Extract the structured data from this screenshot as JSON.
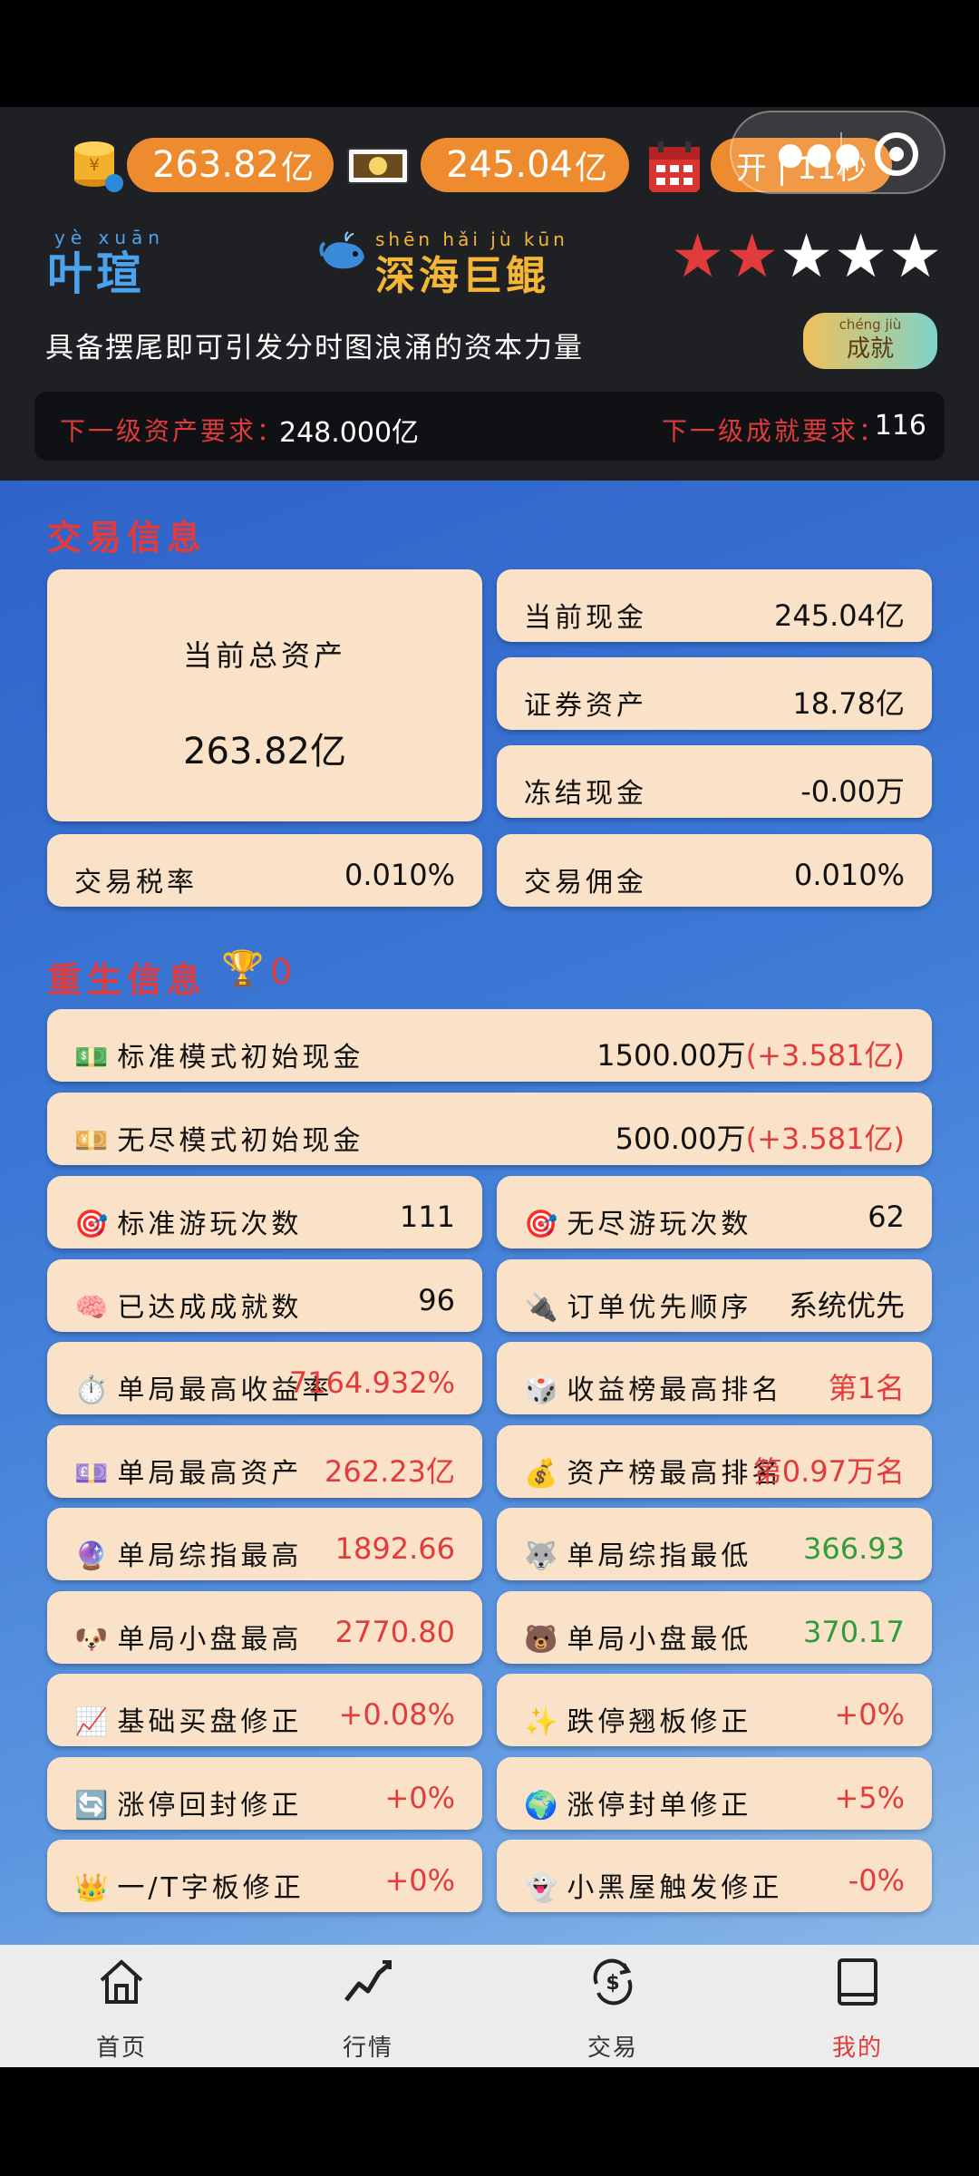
{
  "header": {
    "total_assets": "263.82",
    "total_unit": "亿",
    "cash": "245.04",
    "cash_unit": "亿",
    "market_status": "开 | 11秒",
    "player_name_pinyin": "yè xuān",
    "player_name": "叶瑄",
    "rank_pinyin": "shēn hǎi jù kūn",
    "rank_name": "深海巨鲲",
    "stars_filled": 2,
    "stars_total": 5,
    "motto": "具备摆尾即可引发分时图浪涌的资本力量",
    "achievement_button": "成就",
    "achievement_button_pinyin": "chéng jiù",
    "next_asset_label": "下一级资产要求：",
    "next_asset_value": "248.000亿",
    "next_achievement_label": "下一级成就要求：",
    "next_achievement_value": "116"
  },
  "trade": {
    "title": "交易信息",
    "total_assets_label": "当前总资产",
    "total_assets_value": "263.82亿",
    "cash_label": "当前现金",
    "cash_value": "245.04亿",
    "securities_label": "证券资产",
    "securities_value": "18.78亿",
    "frozen_label": "冻结现金",
    "frozen_value": "-0.00万",
    "tax_label": "交易税率",
    "tax_value": "0.010%",
    "commission_label": "交易佣金",
    "commission_value": "0.010%"
  },
  "rebirth": {
    "title": "重生信息",
    "trophy_count": "0",
    "standard_cash_label": "标准模式初始现金",
    "standard_cash_value": "1500.00万",
    "standard_cash_extra": "(+3.581亿)",
    "endless_cash_label": "无尽模式初始现金",
    "endless_cash_value": "500.00万",
    "endless_cash_extra": "(+3.581亿)",
    "rows": [
      {
        "left_icon": "🎯",
        "left_label": "标准游玩次数",
        "left_value": "111",
        "left_color": "",
        "right_icon": "🎯",
        "right_label": "无尽游玩次数",
        "right_value": "62",
        "right_color": ""
      },
      {
        "left_icon": "🧠",
        "left_label": "已达成成就数",
        "left_value": "96",
        "left_color": "",
        "right_icon": "🔌",
        "right_label": "订单优先顺序",
        "right_value": "系统优先",
        "right_color": ""
      },
      {
        "left_icon": "⏱️",
        "left_label": "单局最高收益率",
        "left_value": "7164.932%",
        "left_color": "red",
        "right_icon": "🎲",
        "right_label": "收益榜最高排名",
        "right_value": "第1名",
        "right_color": "red"
      },
      {
        "left_icon": "💷",
        "left_label": "单局最高资产",
        "left_value": "262.23亿",
        "left_color": "red",
        "right_icon": "💰",
        "right_label": "资产榜最高排名",
        "right_value": "第0.97万名",
        "right_color": "red"
      },
      {
        "left_icon": "🔮",
        "left_label": "单局综指最高",
        "left_value": "1892.66",
        "left_color": "red",
        "right_icon": "🐺",
        "right_label": "单局综指最低",
        "right_value": "366.93",
        "right_color": "green"
      },
      {
        "left_icon": "🐶",
        "left_label": "单局小盘最高",
        "left_value": "2770.80",
        "left_color": "red",
        "right_icon": "🐻",
        "right_label": "单局小盘最低",
        "right_value": "370.17",
        "right_color": "green"
      },
      {
        "left_icon": "📈",
        "left_label": "基础买盘修正",
        "left_value": "+0.08%",
        "left_color": "red",
        "right_icon": "✨",
        "right_label": "跌停翘板修正",
        "right_value": "+0%",
        "right_color": "red"
      },
      {
        "left_icon": "🔄",
        "left_label": "涨停回封修正",
        "left_value": "+0%",
        "left_color": "red",
        "right_icon": "🌍",
        "right_label": "涨停封单修正",
        "right_value": "+5%",
        "right_color": "red"
      },
      {
        "left_icon": "👑",
        "left_label": "一/T字板修正",
        "left_value": "+0%",
        "left_color": "red",
        "right_icon": "👻",
        "right_label": "小黑屋触发修正",
        "right_value": "-0%",
        "right_color": "red"
      }
    ]
  },
  "nav": {
    "home": "首页",
    "market": "行情",
    "trade": "交易",
    "mine": "我的",
    "active": "mine"
  },
  "colors": {
    "accent_red": "#e23b3b",
    "header_bg": "#1f2024",
    "card_bg": "#f9e2c8",
    "pill_orange": "#ee8b2e",
    "green": "#2f9d3a"
  }
}
